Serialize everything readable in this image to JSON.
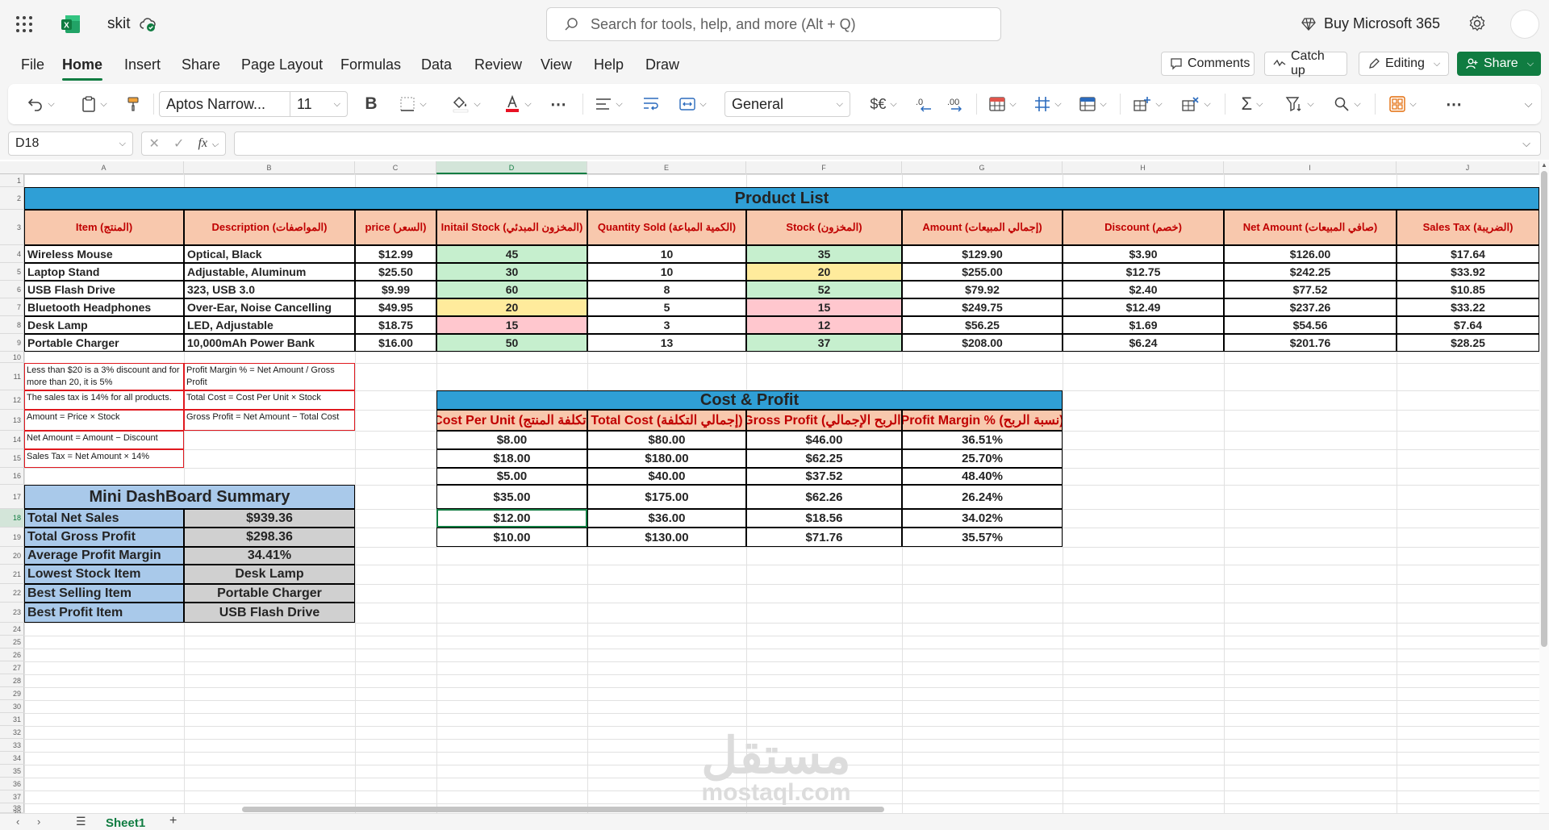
{
  "app": {
    "doc_title": "skit",
    "search_placeholder": "Search for tools, help, and more (Alt + Q)",
    "buy_label": "Buy Microsoft 365"
  },
  "menu": {
    "tabs": [
      "File",
      "Home",
      "Insert",
      "Share",
      "Page Layout",
      "Formulas",
      "Data",
      "Review",
      "View",
      "Help",
      "Draw"
    ],
    "active": "Home"
  },
  "header_buttons": {
    "comments": "Comments",
    "catchup": "Catch up",
    "editing": "Editing",
    "share": "Share"
  },
  "ribbon": {
    "font_name": "Aptos Narrow...",
    "font_size": "11",
    "number_format": "General",
    "bold": "B",
    "currency": "$€",
    "sum": "Σ"
  },
  "formula_bar": {
    "name_box": "D18",
    "fx": "fx",
    "value": ""
  },
  "columns": [
    "A",
    "B",
    "C",
    "D",
    "E",
    "F",
    "G",
    "H",
    "I",
    "J"
  ],
  "rows": [
    "1",
    "2",
    "3",
    "4",
    "5",
    "6",
    "7",
    "8",
    "9",
    "10",
    "11",
    "12",
    "13",
    "14",
    "15",
    "16",
    "17",
    "18",
    "19",
    "20",
    "21",
    "22",
    "23",
    "24",
    "25",
    "26",
    "27",
    "28",
    "29",
    "30",
    "31",
    "32",
    "33",
    "34",
    "35",
    "36",
    "37",
    "38",
    "39"
  ],
  "active_column": "D",
  "active_row": "18",
  "colors": {
    "accent": "#107c41",
    "header_blue": "#2f9fd6",
    "header_peach": "#f8c8ad",
    "green_fill": "#c6efce",
    "yellow_fill": "#ffeb9c",
    "pink_fill": "#ffc7ce",
    "dash_blue": "#a9c9ea",
    "dash_gray": "#d0d0d0",
    "note_red": "#e0191f",
    "cost_red_text": "#c00000"
  },
  "product_list": {
    "title": "Product List",
    "headers": [
      "Item (المنتج)",
      "Description (المواصفات)",
      "price (السعر)",
      "Initail Stock (المخزون المبدئي)",
      "Quantity Sold (الكمية المباعة)",
      "Stock (المخزون)",
      "Amount (إجمالي المبيعات)",
      "Discount (خصم)",
      "Net Amount (صافي المبيعات)",
      "Sales Tax (الضريبة)"
    ],
    "rows": [
      {
        "item": "Wireless Mouse",
        "desc": "Optical, Black",
        "price": "$12.99",
        "initial": "45",
        "initial_fill": "green",
        "sold": "10",
        "stock": "35",
        "stock_fill": "green",
        "amount": "$129.90",
        "discount": "$3.90",
        "net": "$126.00",
        "tax": "$17.64"
      },
      {
        "item": "Laptop Stand",
        "desc": "Adjustable, Aluminum",
        "price": "$25.50",
        "initial": "30",
        "initial_fill": "green",
        "sold": "10",
        "stock": "20",
        "stock_fill": "yellow",
        "amount": "$255.00",
        "discount": "$12.75",
        "net": "$242.25",
        "tax": "$33.92"
      },
      {
        "item": "USB Flash Drive",
        "desc": "323, USB 3.0",
        "price": "$9.99",
        "initial": "60",
        "initial_fill": "green",
        "sold": "8",
        "stock": "52",
        "stock_fill": "green",
        "amount": "$79.92",
        "discount": "$2.40",
        "net": "$77.52",
        "tax": "$10.85"
      },
      {
        "item": "Bluetooth Headphones",
        "desc": "Over-Ear, Noise Cancelling",
        "price": "$49.95",
        "initial": "20",
        "initial_fill": "yellow",
        "sold": "5",
        "stock": "15",
        "stock_fill": "pink",
        "amount": "$249.75",
        "discount": "$12.49",
        "net": "$237.26",
        "tax": "$33.22"
      },
      {
        "item": "Desk Lamp",
        "desc": "LED, Adjustable",
        "price": "$18.75",
        "initial": "15",
        "initial_fill": "pink",
        "sold": "3",
        "stock": "12",
        "stock_fill": "pink",
        "amount": "$56.25",
        "discount": "$1.69",
        "net": "$54.56",
        "tax": "$7.64"
      },
      {
        "item": "Portable Charger",
        "desc": "10,000mAh Power Bank",
        "price": "$16.00",
        "initial": "50",
        "initial_fill": "green",
        "sold": "13",
        "stock": "37",
        "stock_fill": "green",
        "amount": "$208.00",
        "discount": "$6.24",
        "net": "$201.76",
        "tax": "$28.25"
      }
    ]
  },
  "notes": {
    "a11": "Less than $20 is a 3% discount and for more than 20, it is 5%",
    "a12": "The sales tax is 14% for all products.",
    "a13": "Amount = Price × Stock",
    "a14": "Net Amount = Amount − Discount",
    "a15": "Sales Tax = Net Amount × 14%",
    "b11": "Profit Margin % = Net Amount / Gross Profit",
    "b12": "Total Cost = Cost Per Unit × Stock",
    "b13": "Gross Profit = Net Amount − Total Cost"
  },
  "cost_profit": {
    "title": "Cost & Profit",
    "headers": [
      "Cost Per Unit (تكلفة المنتج)",
      "Total Cost (إجمالي التكلفة)",
      "Gross Profit (الربح الإجمالي)",
      "Profit Margin % (نسبة الربح)"
    ],
    "rows": [
      [
        "$8.00",
        "$80.00",
        "$46.00",
        "36.51%"
      ],
      [
        "$18.00",
        "$180.00",
        "$62.25",
        "25.70%"
      ],
      [
        "$5.00",
        "$40.00",
        "$37.52",
        "48.40%"
      ],
      [
        "$35.00",
        "$175.00",
        "$62.26",
        "26.24%"
      ],
      [
        "$12.00",
        "$36.00",
        "$18.56",
        "34.02%"
      ],
      [
        "$10.00",
        "$130.00",
        "$71.76",
        "35.57%"
      ]
    ]
  },
  "dashboard": {
    "title": "Mini DashBoard Summary",
    "rows": [
      {
        "label": "Total Net Sales",
        "value": "$939.36"
      },
      {
        "label": "Total Gross Profit",
        "value": "$298.36"
      },
      {
        "label": "Average Profit Margin",
        "value": "34.41%"
      },
      {
        "label": "Lowest Stock Item",
        "value": "Desk Lamp"
      },
      {
        "label": "Best Selling Item",
        "value": "Portable Charger"
      },
      {
        "label": "Best Profit Item",
        "value": "USB Flash Drive"
      }
    ]
  },
  "watermark": {
    "arabic": "مستقل",
    "latin": "mostaql.com"
  },
  "sheet": {
    "tab": "Sheet1"
  }
}
